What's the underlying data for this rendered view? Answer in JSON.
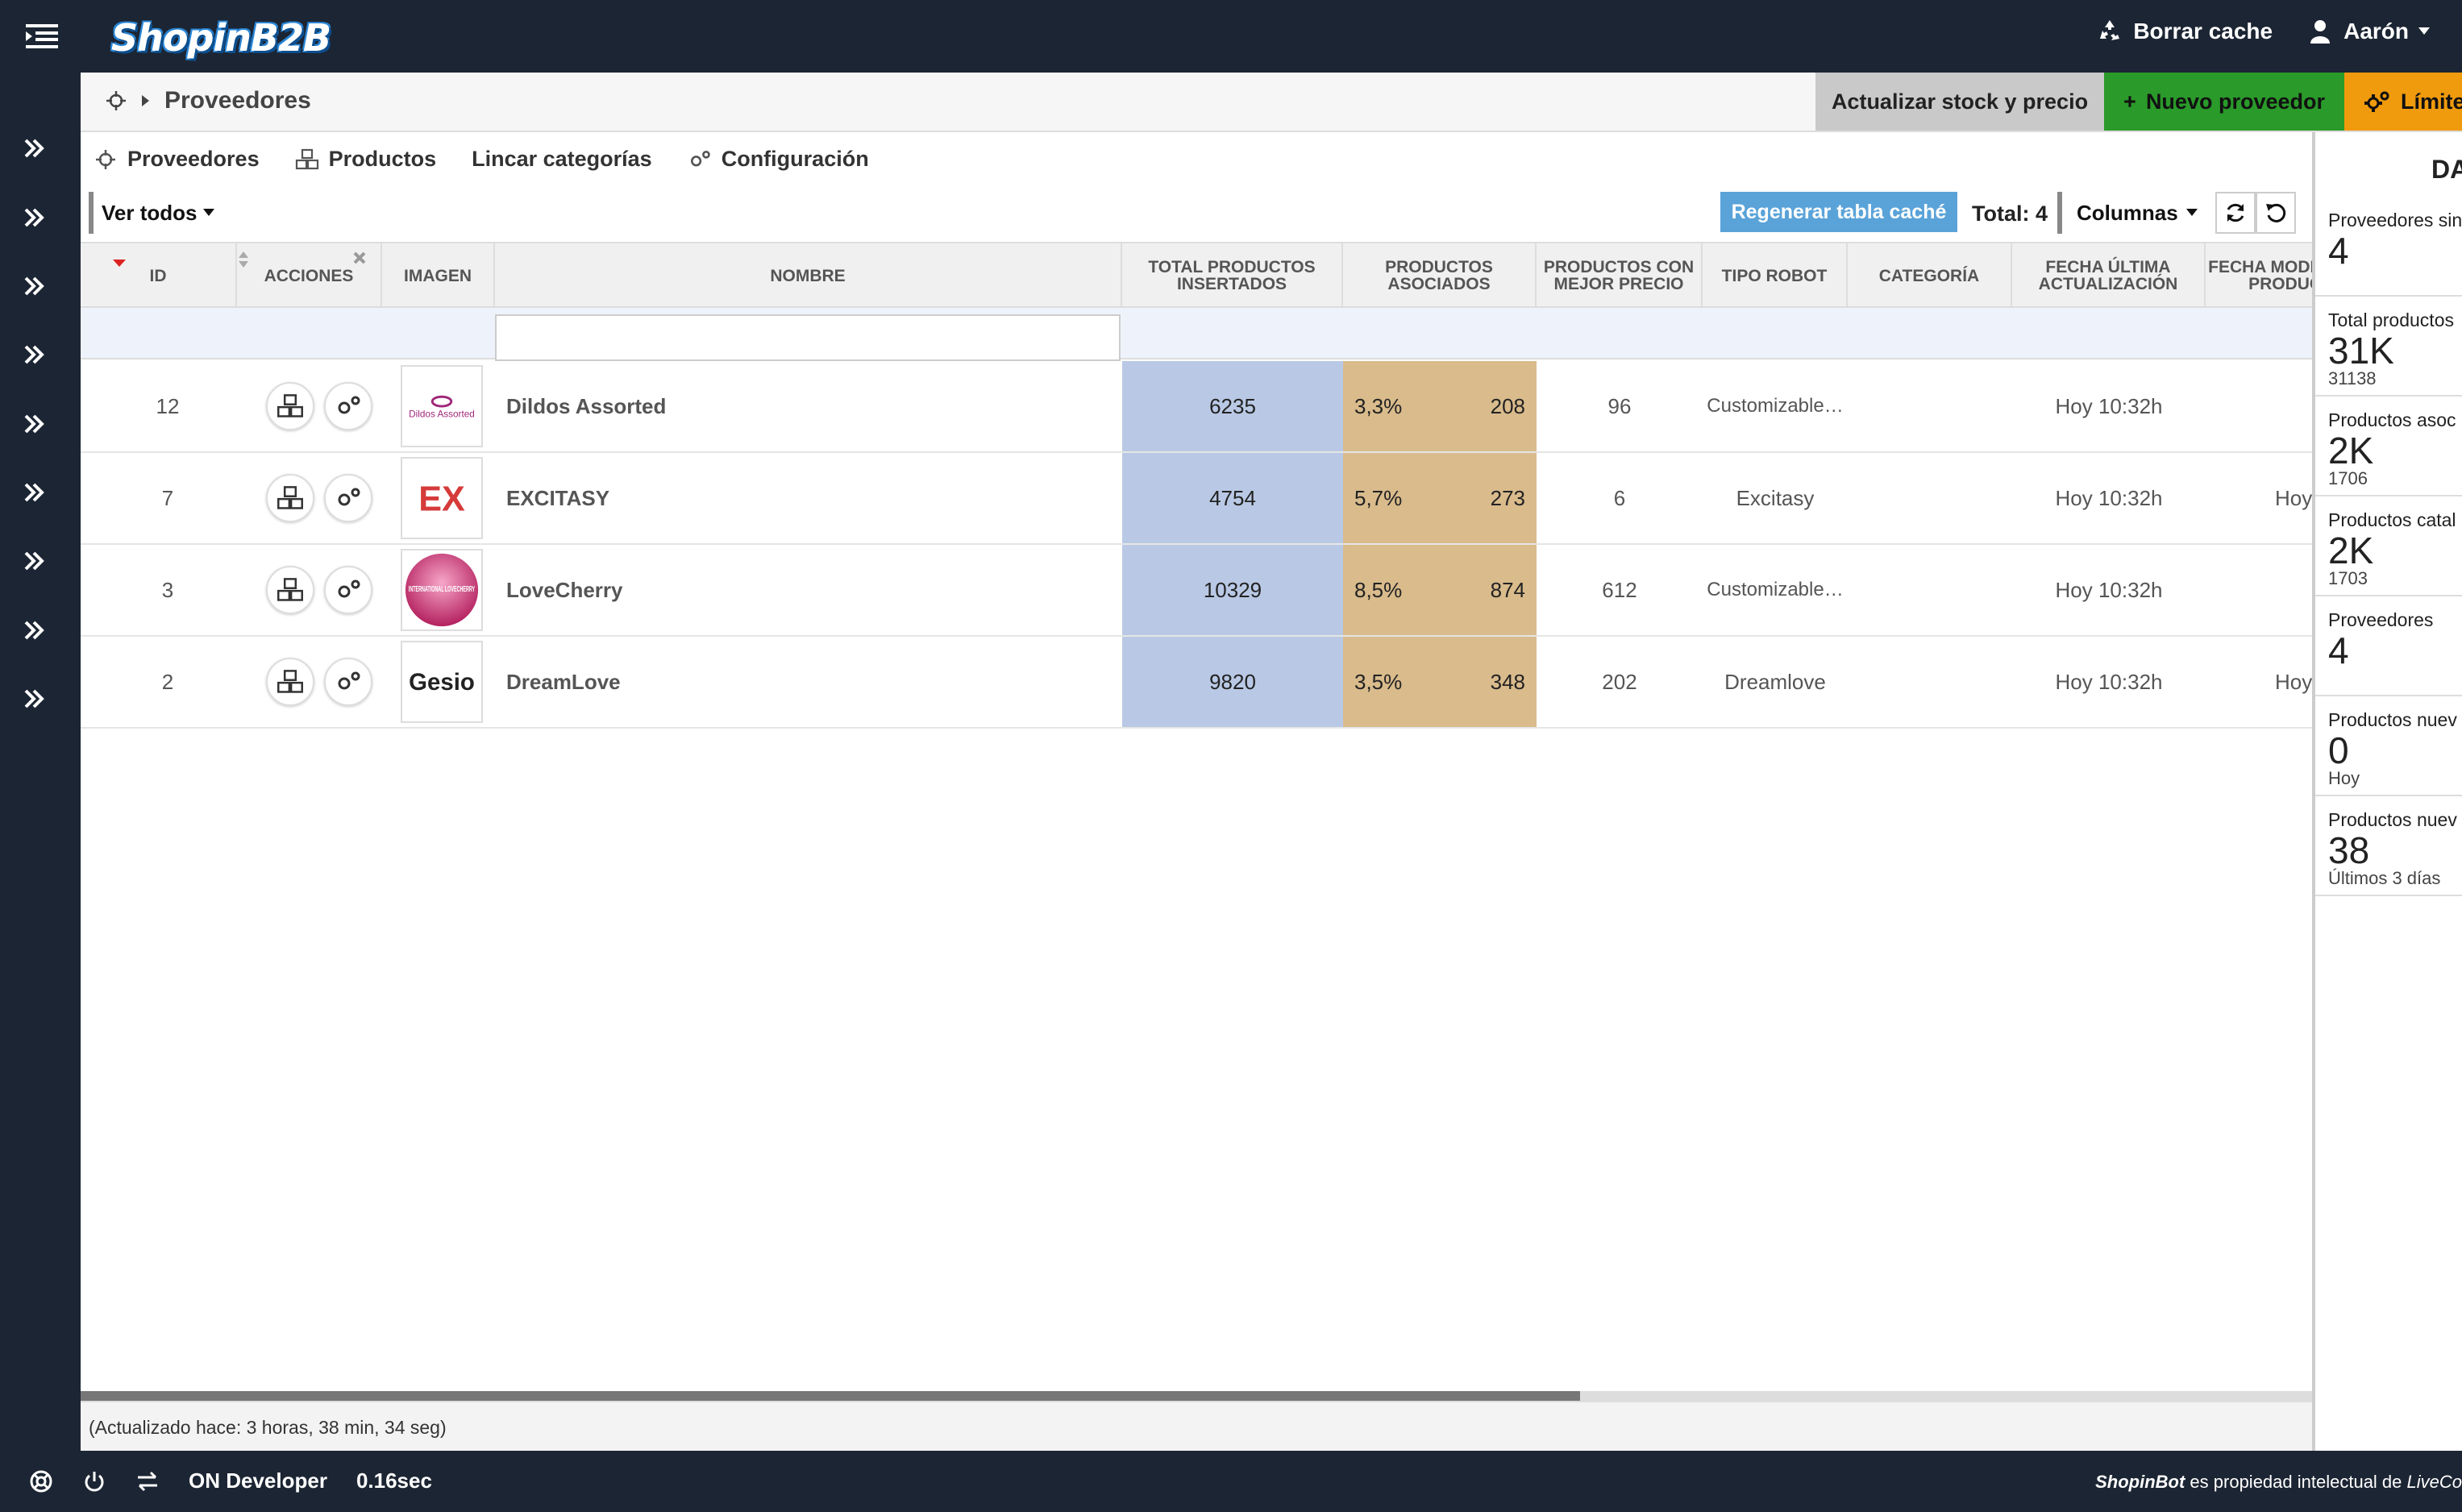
{
  "app": {
    "logo": "ShopinB2B"
  },
  "topbar": {
    "clear_cache": "Borrar cache",
    "user": "Aarón"
  },
  "breadcrumb": {
    "title": "Proveedores"
  },
  "header_buttons": {
    "stock": "Actualizar stock y precio",
    "new_supplier": "Nuevo proveedor",
    "limits": "Límite"
  },
  "tabs": [
    {
      "label": "Proveedores",
      "icon": "crosshair-icon"
    },
    {
      "label": "Productos",
      "icon": "cubes-icon"
    },
    {
      "label": "Lincar categorías",
      "icon": ""
    },
    {
      "label": "Configuración",
      "icon": "gears-icon"
    }
  ],
  "toolbar": {
    "filter": "Ver todos",
    "regen": "Regenerar tabla caché",
    "total": "Total: 4",
    "columns": "Columnas"
  },
  "table": {
    "headers": {
      "id": "ID",
      "actions": "ACCIONES",
      "image": "IMAGEN",
      "name": "NOMBRE",
      "total": "TOTAL PRODUCTOS INSERTADOS",
      "assoc": "PRODUCTOS ASOCIADOS",
      "best": "PRODUCTOS CON MEJOR PRECIO",
      "robot": "TIPO ROBOT",
      "category": "CATEGORÍA",
      "updated": "FECHA ÚLTIMA ACTUALIZACIÓN",
      "modified": "FECHA MODIFICACIÓN PRODUCTOS"
    },
    "rows": [
      {
        "id": "12",
        "name": "Dildos Assorted",
        "total": "6235",
        "pct": "3,3%",
        "assoc": "208",
        "best": "96",
        "robot": "Customizable…",
        "updated": "Hoy 10:32h",
        "modified": "",
        "logo_text": "Dildos Assorted"
      },
      {
        "id": "7",
        "name": "EXCITASY",
        "total": "4754",
        "pct": "5,7%",
        "assoc": "273",
        "best": "6",
        "robot": "Excitasy",
        "updated": "Hoy 10:32h",
        "modified": "Hoy",
        "logo_text": "EX"
      },
      {
        "id": "3",
        "name": "LoveCherry",
        "total": "10329",
        "pct": "8,5%",
        "assoc": "874",
        "best": "612",
        "robot": "Customizable…",
        "updated": "Hoy 10:32h",
        "modified": "",
        "logo_text": "INTERNATIONAL LOVECHERRY"
      },
      {
        "id": "2",
        "name": "DreamLove",
        "total": "9820",
        "pct": "3,5%",
        "assoc": "348",
        "best": "202",
        "robot": "Dreamlove",
        "updated": "Hoy 10:32h",
        "modified": "Hoy",
        "logo_text": "Gesio"
      }
    ]
  },
  "updated_note": "(Actualizado hace: 3 horas, 38 min, 34 seg)",
  "right_panel": {
    "title": "DA",
    "stats": [
      {
        "label": "Proveedores sin",
        "big": "4",
        "sub": ""
      },
      {
        "label": "Total productos",
        "big": "31K",
        "sub": "31138"
      },
      {
        "label": "Productos asoc",
        "big": "2K",
        "sub": "1706"
      },
      {
        "label": "Productos catal",
        "big": "2K",
        "sub": "1703"
      },
      {
        "label": "Proveedores",
        "big": "4",
        "sub": ""
      },
      {
        "label": "Productos nuev",
        "big": "0",
        "sub": "Hoy"
      },
      {
        "label": "Productos nuev",
        "big": "38",
        "sub": "Últimos 3 días"
      }
    ]
  },
  "footer": {
    "mode": "ON Developer",
    "time": "0.16sec",
    "brand": "ShopinBot",
    "text": " es propiedad intelectual de ",
    "owner": "LiveCo"
  },
  "colors": {
    "topbar": "#1c2533",
    "new_supplier": "#2a9a2a",
    "limits": "#f09a0d",
    "regen": "#5aa3d9",
    "total_col": "#b9c9e5",
    "assoc_col": "#d9bb8c"
  }
}
